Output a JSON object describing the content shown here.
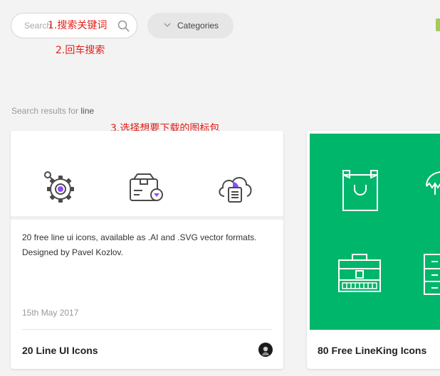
{
  "search": {
    "placeholder": "Search"
  },
  "categories_button": {
    "label": "Categories"
  },
  "annotations": {
    "step1": "1.搜索关键词",
    "step2": "2.回车搜索",
    "step3": "3.选择想要下载的图标包"
  },
  "results": {
    "prefix": "Search results for ",
    "term": "line"
  },
  "cards": [
    {
      "description_line1": "20 free line ui icons, available as .AI and .SVG vector formats.",
      "description_line2": "Designed by Pavel Kozlov.",
      "date": "15th May 2017",
      "title": "20 Line UI Icons",
      "preview_icons": [
        "gear-icon",
        "package-icon",
        "cloud-document-icon"
      ]
    },
    {
      "title": "80 Free LineKing Icons",
      "preview_background": "#00b66b",
      "preview_icons": [
        "shopping-bag-icon",
        "umbrella-icon",
        "briefcase-icon",
        "cabinet-icon"
      ]
    }
  ],
  "colors": {
    "annotation": "#e0201a",
    "accent_purple": "#8a4dff",
    "card2_green": "#00b66b"
  }
}
